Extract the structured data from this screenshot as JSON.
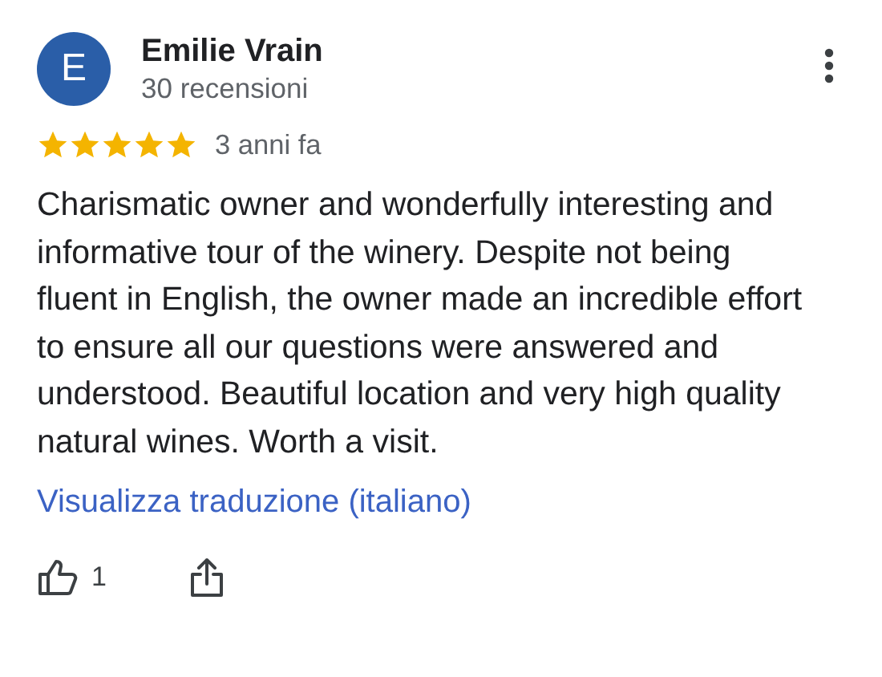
{
  "review": {
    "avatar_letter": "E",
    "author": "Emilie Vrain",
    "review_count": "30 recensioni",
    "stars": 5,
    "time": "3 anni fa",
    "text": "Charismatic owner and wonderfully interesting and informative tour of the winery. Despite not being fluent in English, the owner made an incredible effort to ensure all our questions were answered and understood. Beautiful location and very high quality natural wines. Worth a visit.",
    "translate_link": "Visualizza traduzione (italiano)",
    "likes": "1"
  }
}
